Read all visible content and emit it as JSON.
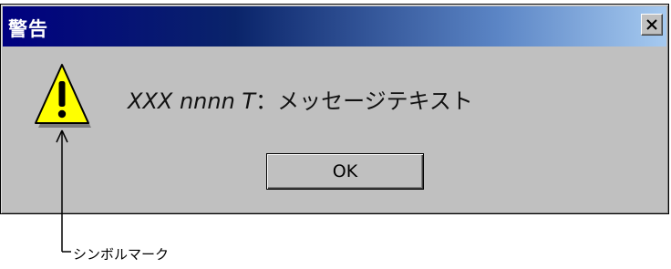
{
  "window": {
    "title": "警告",
    "close_icon": "close-x-icon"
  },
  "body": {
    "icon": "warning-triangle-icon",
    "message_code": "XXX nnnn T",
    "message_separator": "：",
    "message_text": "メッセージテキスト"
  },
  "buttons": {
    "ok_label": "OK"
  },
  "annotation": {
    "label": "シンボルマーク"
  },
  "colors": {
    "titlebar_start": "#000080",
    "titlebar_end": "#a6caf0",
    "dialog_face": "#c0c0c0",
    "warning_fill": "#ffff00"
  }
}
